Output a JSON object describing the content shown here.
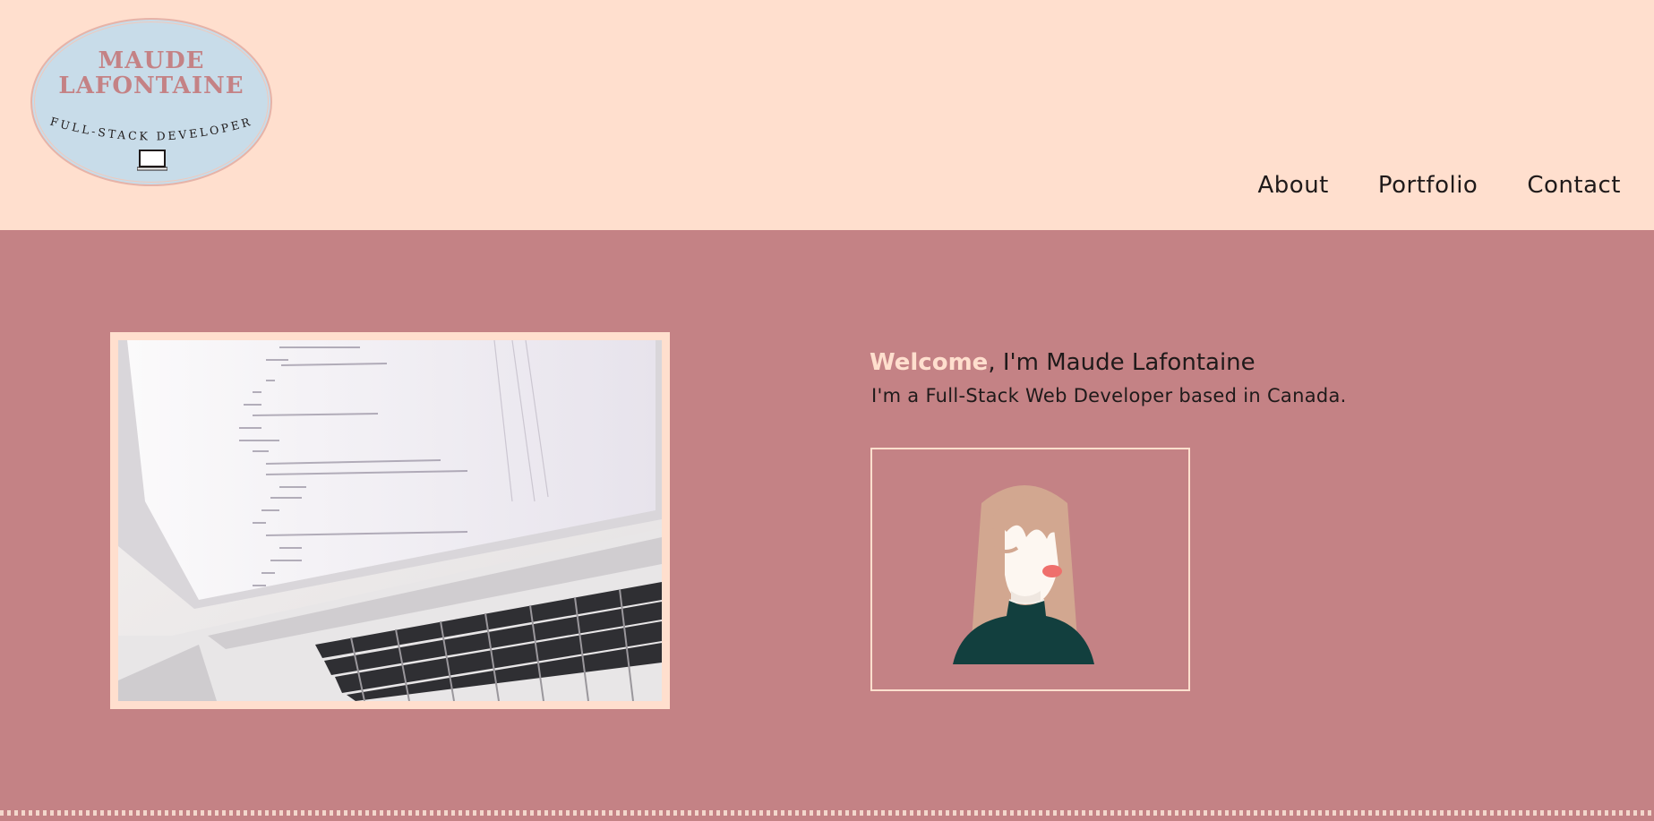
{
  "logo": {
    "name_line1": "MAUDE",
    "name_line2": "LAFONTAINE",
    "subtitle": "FULL-STACK DEVELOPER"
  },
  "nav": {
    "items": [
      {
        "label": "About"
      },
      {
        "label": "Portfolio"
      },
      {
        "label": "Contact"
      }
    ]
  },
  "hero": {
    "welcome": "Welcome",
    "title_rest": ", I'm Maude Lafontaine",
    "subtitle": "I'm a Full-Stack Web Developer based in Canada."
  },
  "colors": {
    "header_bg": "#ffdfce",
    "main_bg": "#c48285",
    "logo_bg": "#c8dce9",
    "accent": "#ffdfce",
    "text": "#1f1a1a",
    "sweater": "#123f3e",
    "hair": "#d2a790"
  }
}
